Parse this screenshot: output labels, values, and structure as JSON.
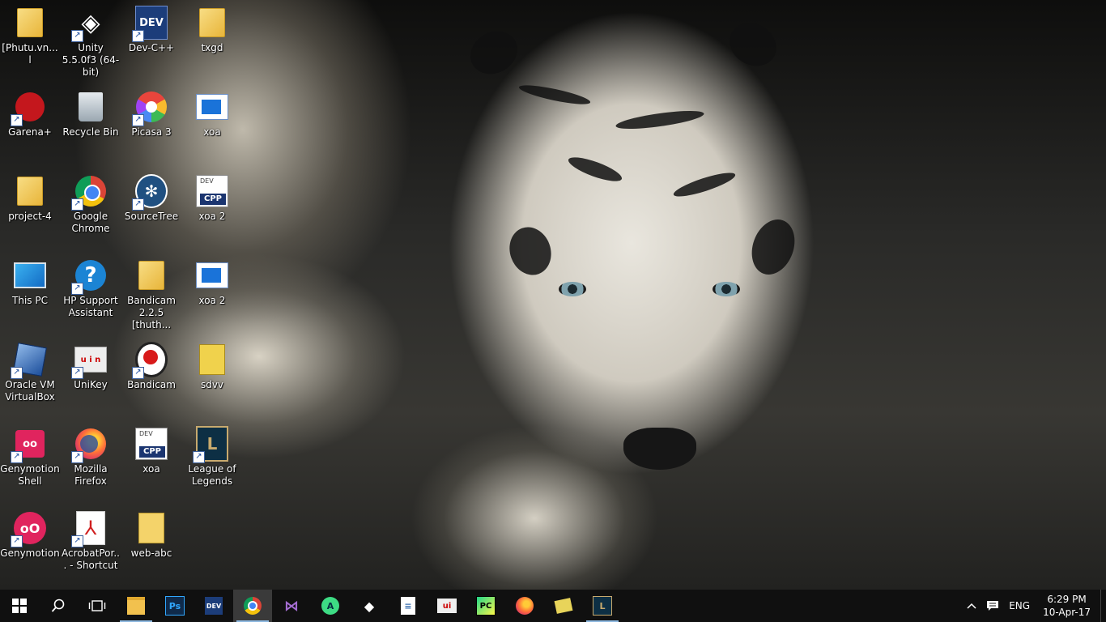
{
  "desktop": {
    "icons": [
      {
        "label": "[Phutu.vn... l",
        "icon": "folder-icon"
      },
      {
        "label": "Unity 5.5.0f3 (64-bit)",
        "icon": "unity-icon"
      },
      {
        "label": "Dev-C++",
        "icon": "devcpp-icon"
      },
      {
        "label": "txgd",
        "icon": "folder-icon"
      },
      {
        "label": "Garena+",
        "icon": "garena-icon"
      },
      {
        "label": "Recycle Bin",
        "icon": "recycle-bin-icon"
      },
      {
        "label": "Picasa 3",
        "icon": "picasa-icon"
      },
      {
        "label": "xoa",
        "icon": "window-icon"
      },
      {
        "label": "project-4",
        "icon": "folder-icon"
      },
      {
        "label": "Google Chrome",
        "icon": "chrome-icon"
      },
      {
        "label": "SourceTree",
        "icon": "sourcetree-icon"
      },
      {
        "label": "xoa 2",
        "icon": "cpp-file-icon"
      },
      {
        "label": "This PC",
        "icon": "computer-icon"
      },
      {
        "label": "HP Support Assistant",
        "icon": "help-icon"
      },
      {
        "label": "Bandicam 2.2.5 [thuth...",
        "icon": "folder-icon"
      },
      {
        "label": "xoa 2",
        "icon": "window-icon"
      },
      {
        "label": "Oracle VM VirtualBox",
        "icon": "virtualbox-icon"
      },
      {
        "label": "UniKey",
        "icon": "unikey-icon"
      },
      {
        "label": "Bandicam",
        "icon": "bandicam-icon"
      },
      {
        "label": "sdvv",
        "icon": "folder-icon"
      },
      {
        "label": "Genymotion Shell",
        "icon": "genymotion-shell-icon"
      },
      {
        "label": "Mozilla Firefox",
        "icon": "firefox-icon"
      },
      {
        "label": "xoa",
        "icon": "cpp-file-icon"
      },
      {
        "label": "League of Legends",
        "icon": "lol-icon"
      },
      {
        "label": "Genymotion",
        "icon": "genymotion-icon"
      },
      {
        "label": "AcrobatPor... - Shortcut",
        "icon": "acrobat-icon"
      },
      {
        "label": "web-abc",
        "icon": "folder-icon"
      }
    ]
  },
  "taskbar": {
    "start_label": "Start",
    "search_label": "Search",
    "task_view_label": "Task View",
    "apps": [
      {
        "name": "File Explorer",
        "icon": "file-explorer-icon",
        "glyph": "",
        "color": "#f2c14e"
      },
      {
        "name": "Photoshop",
        "icon": "photoshop-icon",
        "glyph": "Ps",
        "color": "#0f2a4a"
      },
      {
        "name": "Dev-C++",
        "icon": "devcpp-icon",
        "glyph": "DEV",
        "color": "#1c3d7a"
      },
      {
        "name": "Google Chrome",
        "icon": "chrome-icon",
        "glyph": "",
        "color": "#4285f4"
      },
      {
        "name": "Visual Studio",
        "icon": "visual-studio-icon",
        "glyph": "⋈",
        "color": "#68217a"
      },
      {
        "name": "Android Studio",
        "icon": "android-studio-icon",
        "glyph": "A",
        "color": "#3ddc84"
      },
      {
        "name": "Unity",
        "icon": "unity-icon",
        "glyph": "◆",
        "color": "#222222"
      },
      {
        "name": "Notepad",
        "icon": "document-icon",
        "glyph": "≡",
        "color": "#9fc3e6"
      },
      {
        "name": "UniKey",
        "icon": "unikey-icon",
        "glyph": "ui",
        "color": "#dddddd"
      },
      {
        "name": "PyCharm",
        "icon": "pycharm-icon",
        "glyph": "PC",
        "color": "#21d789"
      },
      {
        "name": "Firefox",
        "icon": "firefox-icon",
        "glyph": "",
        "color": "#ff7139"
      },
      {
        "name": "Sticky",
        "icon": "folder-icon",
        "glyph": "",
        "color": "#e8d45a"
      },
      {
        "name": "League of Legends",
        "icon": "lol-icon",
        "glyph": "L",
        "color": "#c8aa6e"
      }
    ],
    "tray": {
      "language": "ENG",
      "time": "6:29 PM",
      "date": "10-Apr-17"
    }
  }
}
